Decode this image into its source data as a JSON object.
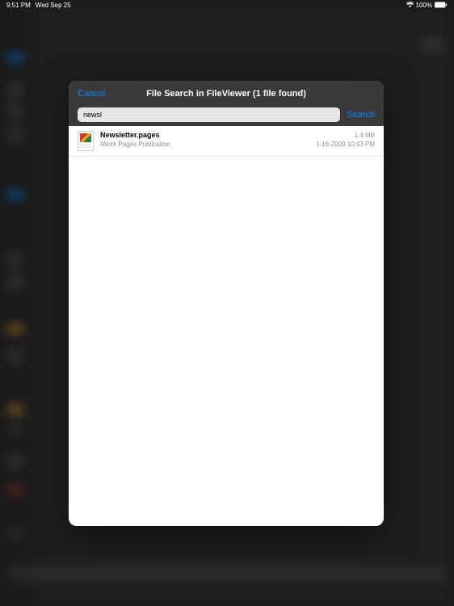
{
  "status": {
    "time": "9:51 PM",
    "date": "Wed Sep 25",
    "battery_pct": "100%"
  },
  "modal": {
    "cancel": "Cancel",
    "title": "File Search in FileViewer (1 file found)",
    "search_value": "newsl",
    "search_button": "Search"
  },
  "results": [
    {
      "name": "Newsletter.pages",
      "size": "1.4 MB",
      "type": "iWork Pages Publication",
      "date": "1-16-2009 10:43 PM"
    }
  ]
}
